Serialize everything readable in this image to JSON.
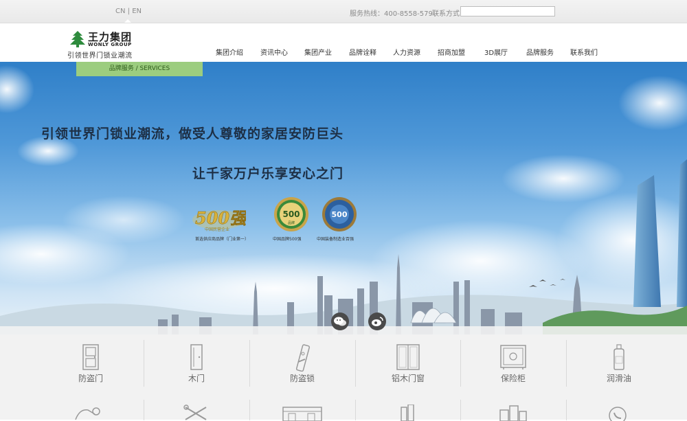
{
  "topbar": {
    "lang_cn": "CN",
    "lang_sep": " | ",
    "lang_en": "EN",
    "hotline": "服务热线：400-8558-579",
    "contact_label": "联系方式",
    "contact_value": ""
  },
  "logo": {
    "name_cn": "王力集团",
    "name_en": "WONLY GROUP",
    "slogan": "引领世界门锁业潮流"
  },
  "nav": [
    {
      "label": "集团介绍",
      "icon": ""
    },
    {
      "label": "资讯中心",
      "icon": ""
    },
    {
      "label": "集团产业",
      "icon": ""
    },
    {
      "label": "品牌诠释",
      "icon": ""
    },
    {
      "label": "人力资源",
      "icon": ""
    },
    {
      "label": "招商加盟",
      "icon": ""
    },
    {
      "label": "3D展厅",
      "icon": ""
    },
    {
      "label": "品牌服务",
      "icon": ""
    },
    {
      "label": "联系我们",
      "icon": ""
    }
  ],
  "breadcrumb": "品牌服务 / SERVICES",
  "banner": {
    "headline1": "引领世界门锁业潮流，做受人尊敬的家居安防巨头",
    "headline2": "让千家万户乐享安心之门",
    "badges": [
      {
        "logo_text": "500强",
        "sub": "中国民营企业",
        "caption": "首选供应商品牌（门业第一）"
      },
      {
        "logo_text": "500",
        "sub": "品牌",
        "caption": "中国品牌500强"
      },
      {
        "logo_text": "500",
        "sub": "",
        "caption": "中国装备制造业百强"
      }
    ]
  },
  "social": [
    {
      "icon": "wechat-icon"
    },
    {
      "icon": "weibo-icon"
    }
  ],
  "products": [
    {
      "label": "防盗门",
      "icon": "security-door-icon"
    },
    {
      "label": "木门",
      "icon": "wooden-door-icon"
    },
    {
      "label": "防盗锁",
      "icon": "lock-icon"
    },
    {
      "label": "铝木门窗",
      "icon": "window-icon"
    },
    {
      "label": "保险柜",
      "icon": "safe-icon"
    },
    {
      "label": "润滑油",
      "icon": "oil-bottle-icon"
    }
  ],
  "colors": {
    "accent_green": "#9ccd7f",
    "logo_green": "#2e8b3d",
    "sky_top": "#2f7fc8",
    "product_bg": "#f2f2f2"
  }
}
